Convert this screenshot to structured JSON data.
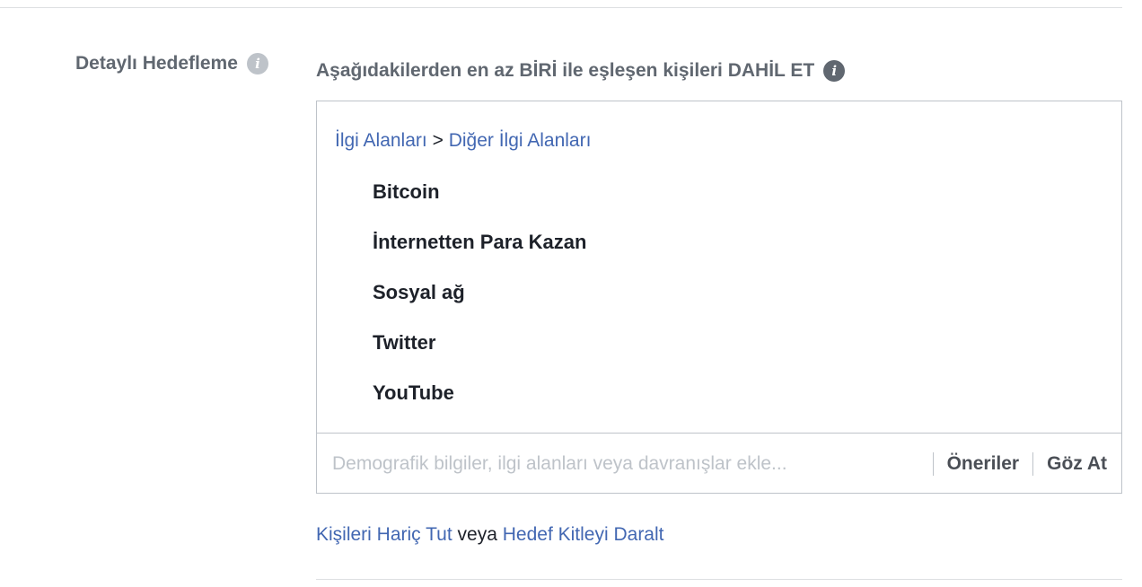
{
  "section": {
    "label": "Detaylı Hedefleme",
    "info_icon": "info-icon"
  },
  "include": {
    "heading": "Aşağıdakilerden en az BİRİ ile eşleşen kişileri DAHİL ET",
    "info_icon": "info-icon"
  },
  "breadcrumb": {
    "parent": "İlgi Alanları",
    "separator": ">",
    "child": "Diğer İlgi Alanları"
  },
  "interests": [
    "Bitcoin",
    "İnternetten Para Kazan",
    "Sosyal ağ",
    "Twitter",
    "YouTube"
  ],
  "search": {
    "placeholder": "Demografik bilgiler, ilgi alanları veya davranışlar ekle...",
    "value": ""
  },
  "actions": {
    "suggestions": "Öneriler",
    "browse": "Göz At"
  },
  "footer": {
    "exclude_link": "Kişileri Hariç Tut",
    "or": "veya",
    "narrow_link": "Hedef Kitleyi Daralt"
  },
  "colors": {
    "link": "#4267b2",
    "label": "#606770",
    "text": "#1d2129",
    "border": "#bec3c9",
    "placeholder": "#bec3c9"
  }
}
